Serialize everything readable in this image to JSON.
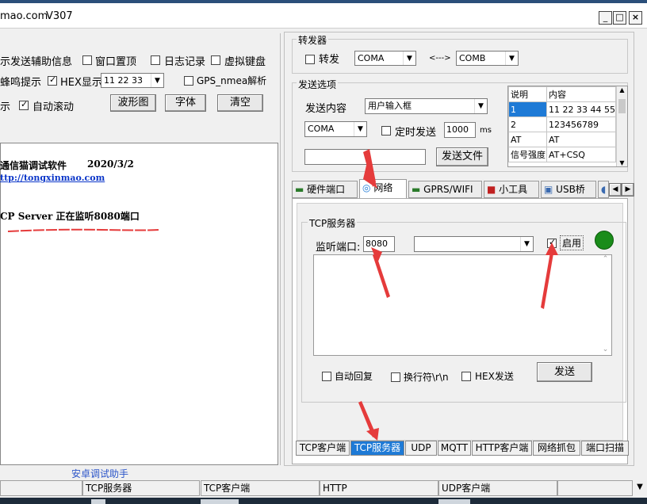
{
  "window": {
    "title_partial": "mao.com",
    "version": "V307",
    "minimize": "_",
    "maximize": "□",
    "close": "×"
  },
  "left_options": {
    "row1": {
      "send_assist": "示发送辅助信息",
      "window_top": "窗口置顶",
      "day_log": "日志记录",
      "virtual_kb": "虚拟键盘"
    },
    "row2": {
      "beep": "蜂鸣提示",
      "hex_show": "HEX显示",
      "hex_value": "11 22 33",
      "gps_parse": "GPS_nmea解析"
    },
    "row3": {
      "show": "示",
      "auto_scroll": "自动滚动",
      "waveform_btn": "波形图",
      "font_btn": "字体",
      "clear_btn": "清空"
    }
  },
  "log": {
    "line1_title": "通信猫调试软件",
    "line1_date": "2020/3/2",
    "line2_url": "ttp://tongxinmao.com",
    "line3": "CP Server 正在监听8080端口"
  },
  "forwarder": {
    "group_label": "转发器",
    "forward_label": "转发",
    "from_port": "COMA",
    "arrow_text": "<--->",
    "to_port": "COMB"
  },
  "send_options": {
    "group_label": "发送选项",
    "content_label": "发送内容",
    "content_value": "用户输入框",
    "port_value": "COMA",
    "timer_label": "定时发送",
    "interval": "1000",
    "interval_unit": "ms",
    "send_file_btn": "发送文件"
  },
  "command_table": {
    "headers": [
      "说明",
      "内容"
    ],
    "rows": [
      [
        "1",
        "11 22 33 44 55"
      ],
      [
        "2",
        "123456789"
      ],
      [
        "AT",
        "AT"
      ],
      [
        "信号强度",
        "AT+CSQ"
      ]
    ]
  },
  "main_tabs": [
    "硬件端口",
    "网络",
    "GPRS/WIFI",
    "小工具",
    "USB桥"
  ],
  "tcp_server": {
    "group_label": "TCP服务器",
    "listen_port_label": "监听端口:",
    "listen_port": "8080",
    "enable_label": "启用",
    "status_color": "#1a8c1a",
    "auto_reply_label": "自动回复",
    "newline_label": "换行符\\r\\n",
    "hex_send_label": "HEX发送",
    "send_btn": "发送"
  },
  "bottom_tabs": [
    "TCP客户端",
    "TCP服务器",
    "UDP",
    "MQTT",
    "HTTP客户端",
    "网络抓包",
    "端口扫描"
  ],
  "bottom_active": "TCP服务器",
  "android_link": "安卓调试助手",
  "status_bar": [
    "TCP服务器",
    "TCP客户端",
    "HTTP",
    "UDP客户端"
  ],
  "colors": {
    "accent": "#1e7ad6",
    "arrow": "#e53b3b",
    "underline": "#e53b3b"
  }
}
